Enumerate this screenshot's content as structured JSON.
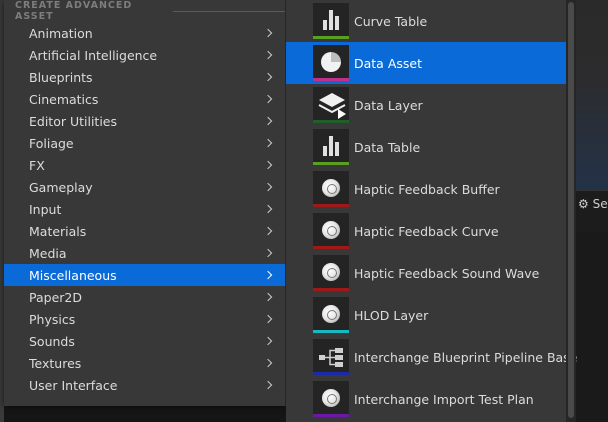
{
  "background": {
    "peek_text": "Set"
  },
  "left_menu": {
    "section_title": "CREATE ADVANCED ASSET",
    "items": [
      {
        "label": "Animation",
        "selected": false
      },
      {
        "label": "Artificial Intelligence",
        "selected": false
      },
      {
        "label": "Blueprints",
        "selected": false
      },
      {
        "label": "Cinematics",
        "selected": false
      },
      {
        "label": "Editor Utilities",
        "selected": false
      },
      {
        "label": "Foliage",
        "selected": false
      },
      {
        "label": "FX",
        "selected": false
      },
      {
        "label": "Gameplay",
        "selected": false
      },
      {
        "label": "Input",
        "selected": false
      },
      {
        "label": "Materials",
        "selected": false
      },
      {
        "label": "Media",
        "selected": false
      },
      {
        "label": "Miscellaneous",
        "selected": true
      },
      {
        "label": "Paper2D",
        "selected": false
      },
      {
        "label": "Physics",
        "selected": false
      },
      {
        "label": "Sounds",
        "selected": false
      },
      {
        "label": "Textures",
        "selected": false
      },
      {
        "label": "User Interface",
        "selected": false
      }
    ]
  },
  "submenu": {
    "items": [
      {
        "label": "Curve Table",
        "icon": "bar-chart-icon",
        "accent": "#5aa020",
        "selected": false
      },
      {
        "label": "Data Asset",
        "icon": "pie-chart-icon",
        "accent": "#c0308a",
        "selected": true
      },
      {
        "label": "Data Layer",
        "icon": "data-layer-icon",
        "accent": "#1f5f2a",
        "selected": false
      },
      {
        "label": "Data Table",
        "icon": "bar-chart-icon",
        "accent": "#5aa020",
        "selected": false
      },
      {
        "label": "Haptic Feedback Buffer",
        "icon": "sphere-icon",
        "accent": "#a01818",
        "selected": false
      },
      {
        "label": "Haptic Feedback Curve",
        "icon": "sphere-icon",
        "accent": "#a01818",
        "selected": false
      },
      {
        "label": "Haptic Feedback Sound Wave",
        "icon": "sphere-icon",
        "accent": "#a01818",
        "selected": false
      },
      {
        "label": "HLOD Layer",
        "icon": "sphere-icon",
        "accent": "#18b8c0",
        "selected": false
      },
      {
        "label": "Interchange Blueprint Pipeline Base",
        "icon": "pipeline-icon",
        "accent": "#1a2aa8",
        "selected": false
      },
      {
        "label": "Interchange Import Test Plan",
        "icon": "sphere-icon",
        "accent": "#6a18a8",
        "selected": false
      }
    ]
  }
}
